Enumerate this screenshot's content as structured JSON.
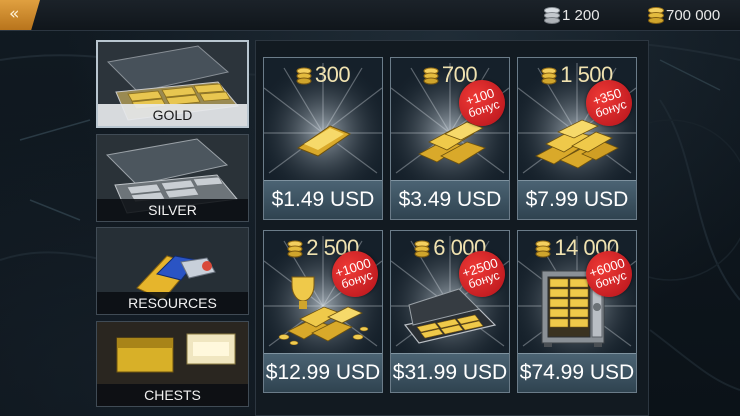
{
  "header": {
    "back_icon": "«",
    "silver_amount": "1 200",
    "gold_amount": "700 000"
  },
  "tabs": [
    {
      "label": "GOLD",
      "active": true
    },
    {
      "label": "SILVER",
      "active": false
    },
    {
      "label": "RESOURCES",
      "active": false
    },
    {
      "label": "CHESTS",
      "active": false
    }
  ],
  "offers": [
    {
      "amount": "300",
      "price": "$1.49 USD",
      "bonus": null,
      "bonus_word": null
    },
    {
      "amount": "700",
      "price": "$3.49 USD",
      "bonus": "+100",
      "bonus_word": "бонус"
    },
    {
      "amount": "1 500",
      "price": "$7.99 USD",
      "bonus": "+350",
      "bonus_word": "бонус"
    },
    {
      "amount": "2 500",
      "price": "$12.99 USD",
      "bonus": "+1000",
      "bonus_word": "бонус"
    },
    {
      "amount": "6 000",
      "price": "$31.99 USD",
      "bonus": "+2500",
      "bonus_word": "бонус"
    },
    {
      "amount": "14 000",
      "price": "$74.99 USD",
      "bonus": "+6000",
      "bonus_word": "бонус"
    }
  ],
  "colors": {
    "gold": "#e0b53a",
    "silver": "#b9bec4",
    "badge_red": "#d1201f",
    "price_bar": "#3f5564",
    "back_button": "#d18b2c"
  },
  "icons": {
    "back": "double-chevron-left-icon",
    "silver_currency": "silver-coin-stack-icon",
    "gold_currency": "gold-coin-stack-icon"
  }
}
